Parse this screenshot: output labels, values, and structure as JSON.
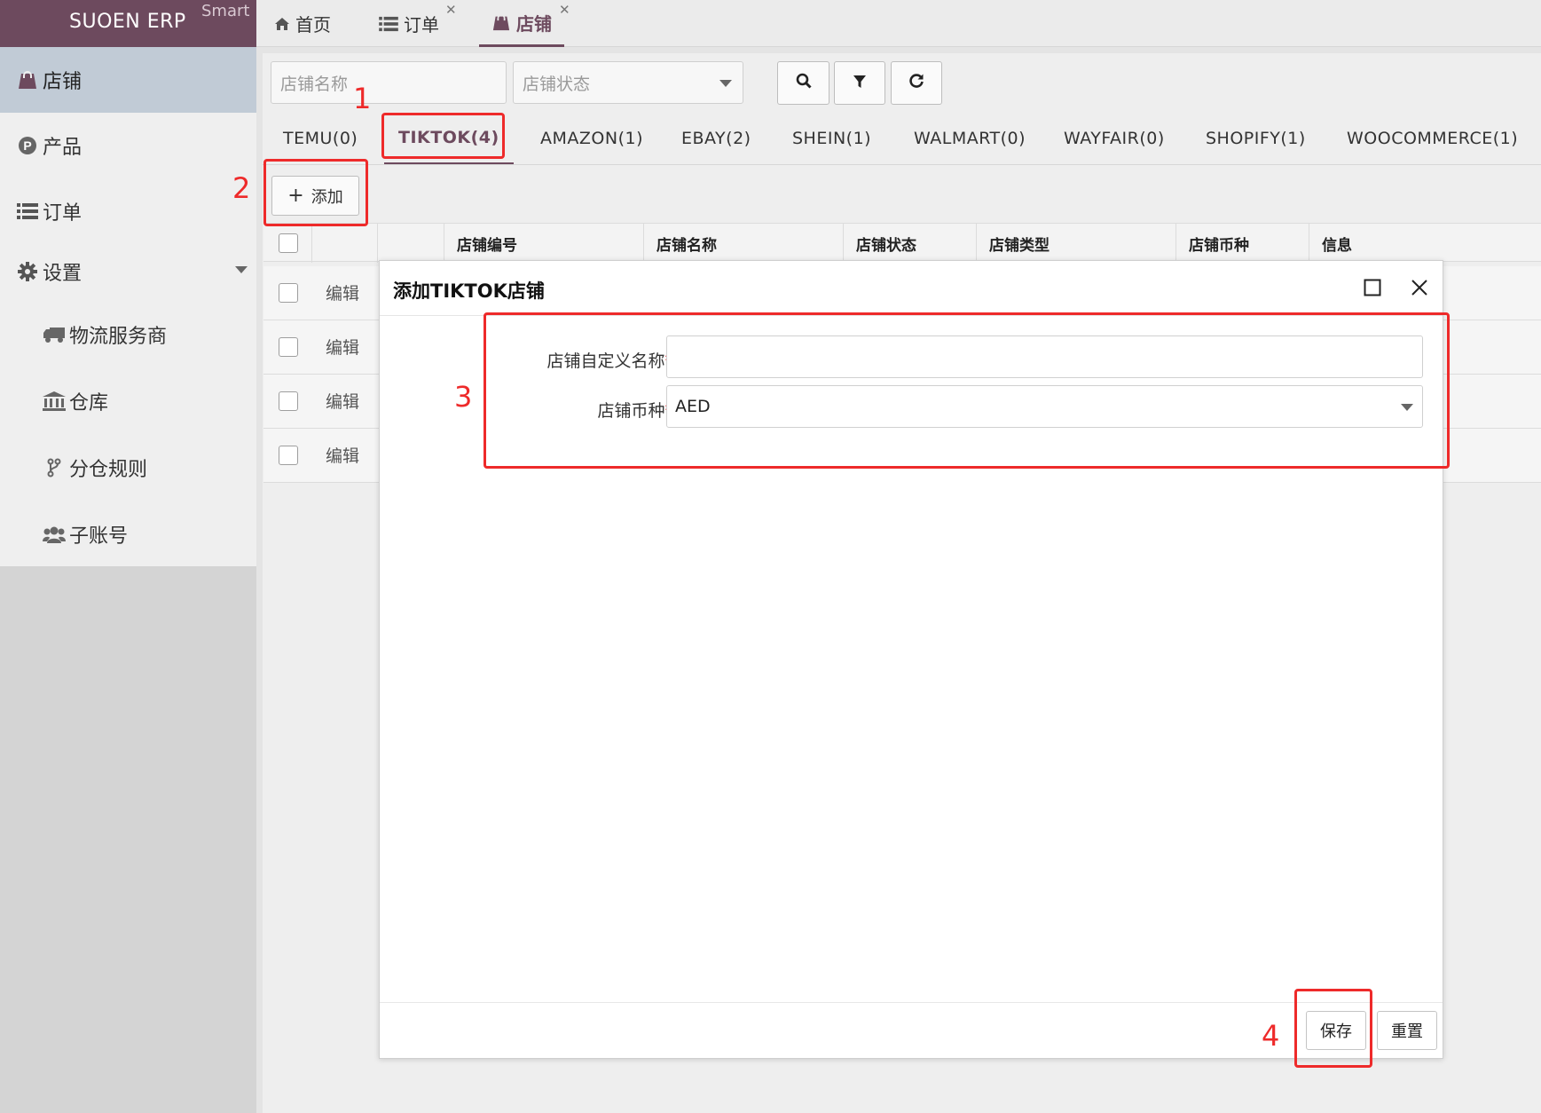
{
  "app": {
    "brand": "SUOEN ERP",
    "brand_sub": "Smart"
  },
  "sidebar": {
    "items": [
      {
        "label": "店铺",
        "icon": "shopping-bag-icon",
        "active": true
      },
      {
        "label": "产品",
        "icon": "product-p-icon"
      },
      {
        "label": "订单",
        "icon": "list-icon"
      },
      {
        "label": "设置",
        "icon": "gear-icon",
        "expandable": true
      },
      {
        "label": "物流服务商",
        "icon": "truck-icon"
      },
      {
        "label": "仓库",
        "icon": "bank-icon"
      },
      {
        "label": "分仓规则",
        "icon": "fork-icon"
      },
      {
        "label": "子账号",
        "icon": "users-icon"
      }
    ]
  },
  "top_tabs": [
    {
      "label": "首页",
      "icon": "home-icon"
    },
    {
      "label": "订单",
      "icon": "list-icon"
    },
    {
      "label": "店铺",
      "icon": "shopping-bag-icon",
      "active": true
    }
  ],
  "search": {
    "name_placeholder": "店铺名称",
    "status_placeholder": "店铺状态"
  },
  "platform_tabs": [
    "TEMU(0)",
    "TIKTOK(4)",
    "AMAZON(1)",
    "EBAY(2)",
    "SHEIN(1)",
    "WALMART(0)",
    "WAYFAIR(0)",
    "SHOPIFY(1)",
    "WOOCOMMERCE(1)"
  ],
  "active_platform_tab": "TIKTOK(4)",
  "toolbar": {
    "add_label": "添加"
  },
  "grid": {
    "columns": [
      "店铺编号",
      "店铺名称",
      "店铺状态",
      "店铺类型",
      "店铺币种",
      "信息"
    ],
    "row_action": "编辑",
    "rows": 4
  },
  "dialog": {
    "title": "添加TIKTOK店铺",
    "fields": {
      "name_label": "店铺自定义名称",
      "currency_label": "店铺币种",
      "required_mark": "*",
      "colon": "：",
      "name_value": "",
      "currency_value": "AED"
    },
    "save_label": "保存",
    "reset_label": "重置"
  },
  "annotations": [
    "1",
    "2",
    "3",
    "4"
  ],
  "colors": {
    "brand": "#6d4a5e",
    "annotation": "#ee2a2a",
    "active_menu": "#c1cbd6"
  }
}
